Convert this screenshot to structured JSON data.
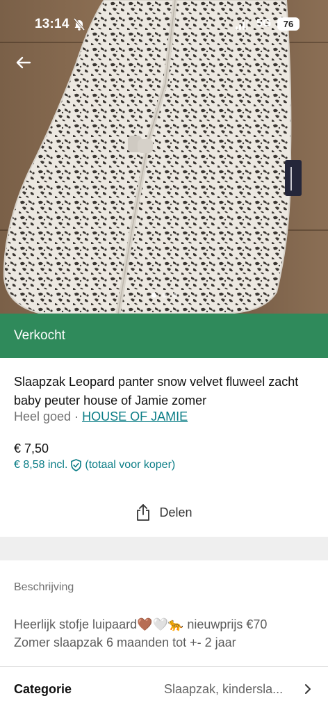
{
  "status_bar": {
    "time": "13:14",
    "network": "5G",
    "battery": "76"
  },
  "icons": {
    "back": "arrow-left-icon",
    "mute": "bell-slash-icon",
    "signal": "signal-icon",
    "share": "share-icon",
    "shield": "shield-check-icon",
    "chevron": "chevron-right-icon"
  },
  "gallery": {
    "image_count": 3,
    "active_index": 0
  },
  "sold_banner": {
    "label": "Verkocht",
    "color": "#2f8a5b"
  },
  "listing": {
    "title": "Slaapzak Leopard panter snow velvet fluweel zacht baby peuter house of Jamie zomer",
    "condition": "Heel goed",
    "separator": " · ",
    "brand": "HOUSE OF JAMIE",
    "price": "€ 7,50",
    "price_incl": "€ 8,58 incl.",
    "price_incl_note": "(totaal voor koper)"
  },
  "actions": {
    "share_label": "Delen"
  },
  "description": {
    "heading": "Beschrijving",
    "line1": "Heerlijk stofje luipaard🤎🤍🐆 nieuwprijs €70",
    "line2": "Zomer slaapzak 6 maanden tot +- 2 jaar"
  },
  "category": {
    "label": "Categorie",
    "value": "Slaapzak, kindersla..."
  },
  "colors": {
    "accent": "#0a7d86",
    "sold_green": "#2f8a5b"
  }
}
